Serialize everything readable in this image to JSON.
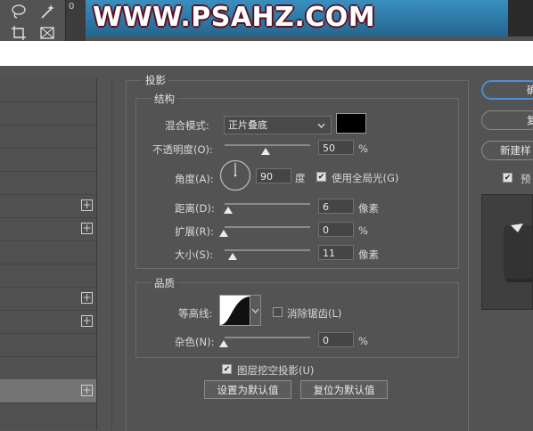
{
  "banner": {
    "text": "WWW.PSAHZ.COM"
  },
  "ruler": {
    "zero": "0"
  },
  "dialog": {
    "section_title": "投影",
    "structure": {
      "title": "结构",
      "blend_mode_label": "混合模式:",
      "blend_mode_value": "正片叠底",
      "shadow_color": "#000000",
      "opacity_label": "不透明度(O):",
      "opacity_value": "50",
      "opacity_unit": "%",
      "angle_label": "角度(A):",
      "angle_value": "90",
      "angle_unit": "度",
      "global_light_label": "使用全局光(G)",
      "global_light_checked": true,
      "distance_label": "距离(D):",
      "distance_value": "6",
      "distance_unit": "像素",
      "spread_label": "扩展(R):",
      "spread_value": "0",
      "spread_unit": "%",
      "size_label": "大小(S):",
      "size_value": "11",
      "size_unit": "像素"
    },
    "quality": {
      "title": "品质",
      "contour_label": "等高线:",
      "anti_alias_label": "消除锯齿(L)",
      "anti_alias_checked": false,
      "noise_label": "杂色(N):",
      "noise_value": "0",
      "noise_unit": "%"
    },
    "knockout_label": "图层挖空投影(U)",
    "knockout_checked": true,
    "set_default_label": "设置为默认值",
    "reset_default_label": "复位为默认值",
    "right_buttons": {
      "ok_label": "确",
      "cancel_label": "复",
      "new_style_label": "新建样",
      "preview_label": "预"
    }
  }
}
